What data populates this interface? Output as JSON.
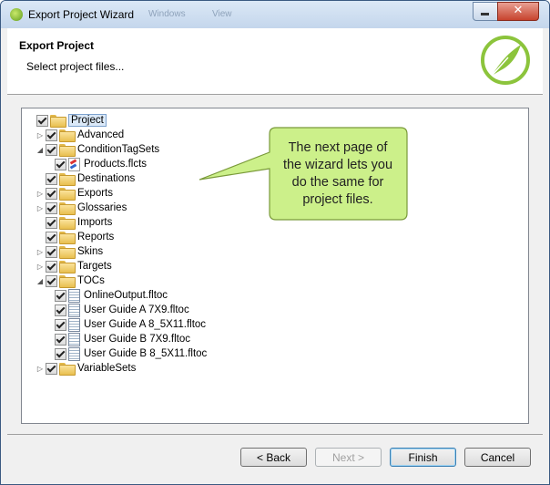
{
  "window": {
    "title": "Export Project Wizard",
    "blurred_tabs": [
      "Windows",
      "View"
    ],
    "close_glyph": "✕"
  },
  "header": {
    "title": "Export Project",
    "subtitle": "Select project files..."
  },
  "tree": {
    "nodes": [
      {
        "label": "Project",
        "level": 0,
        "twisty": "",
        "checked": true,
        "icon": "folder-open-icon",
        "selected": true
      },
      {
        "label": "Advanced",
        "level": 1,
        "twisty": "▷",
        "checked": true,
        "icon": "folder-icon"
      },
      {
        "label": "ConditionTagSets",
        "level": 1,
        "twisty": "◢",
        "checked": true,
        "icon": "folder-icon"
      },
      {
        "label": "Products.flcts",
        "level": 2,
        "twisty": "",
        "checked": true,
        "icon": "condition-tag-file-icon"
      },
      {
        "label": "Destinations",
        "level": 1,
        "twisty": "",
        "checked": true,
        "icon": "folder-icon"
      },
      {
        "label": "Exports",
        "level": 1,
        "twisty": "▷",
        "checked": true,
        "icon": "folder-icon"
      },
      {
        "label": "Glossaries",
        "level": 1,
        "twisty": "▷",
        "checked": true,
        "icon": "folder-icon"
      },
      {
        "label": "Imports",
        "level": 1,
        "twisty": "",
        "checked": true,
        "icon": "folder-icon"
      },
      {
        "label": "Reports",
        "level": 1,
        "twisty": "",
        "checked": true,
        "icon": "folder-icon"
      },
      {
        "label": "Skins",
        "level": 1,
        "twisty": "▷",
        "checked": true,
        "icon": "folder-icon"
      },
      {
        "label": "Targets",
        "level": 1,
        "twisty": "▷",
        "checked": true,
        "icon": "folder-icon"
      },
      {
        "label": "TOCs",
        "level": 1,
        "twisty": "◢",
        "checked": true,
        "icon": "folder-icon"
      },
      {
        "label": "OnlineOutput.fltoc",
        "level": 2,
        "twisty": "",
        "checked": true,
        "icon": "toc-file-icon"
      },
      {
        "label": "User Guide A 7X9.fltoc",
        "level": 2,
        "twisty": "",
        "checked": true,
        "icon": "toc-file-icon"
      },
      {
        "label": "User Guide A 8_5X11.fltoc",
        "level": 2,
        "twisty": "",
        "checked": true,
        "icon": "toc-file-icon"
      },
      {
        "label": "User Guide B 7X9.fltoc",
        "level": 2,
        "twisty": "",
        "checked": true,
        "icon": "toc-file-icon"
      },
      {
        "label": "User Guide B 8_5X11.fltoc",
        "level": 2,
        "twisty": "",
        "checked": true,
        "icon": "toc-file-icon"
      },
      {
        "label": "VariableSets",
        "level": 1,
        "twisty": "▷",
        "checked": true,
        "icon": "folder-icon"
      }
    ]
  },
  "callout": {
    "lines": [
      "The next page of",
      "the wizard lets you",
      "do the same for",
      "project files."
    ],
    "fill": "#ccf08a",
    "stroke": "#7a9a3a"
  },
  "buttons": {
    "back": "< Back",
    "next": "Next >",
    "finish": "Finish",
    "cancel": "Cancel"
  }
}
